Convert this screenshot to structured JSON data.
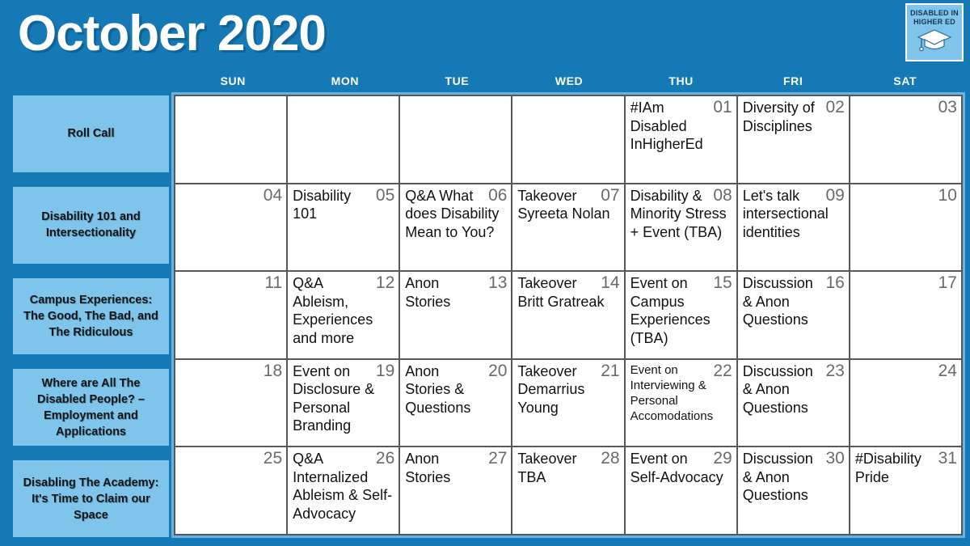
{
  "header": {
    "title": "October 2020"
  },
  "logo": {
    "line1": "DISABLED IN",
    "line2": "HIGHER ED",
    "icon": "graduation-cap-icon"
  },
  "weekdays": [
    "SUN",
    "MON",
    "TUE",
    "WED",
    "THU",
    "FRI",
    "SAT"
  ],
  "sidebar": {
    "items": [
      {
        "label": "Roll Call"
      },
      {
        "label": "Disability 101 and Intersectionality"
      },
      {
        "label": "Campus Experiences: The Good, The Bad, and The Ridiculous"
      },
      {
        "label": "Where are All The Disabled People? – Employment and Applications"
      },
      {
        "label": "Disabling The Academy: It's Time to Claim our Space"
      }
    ]
  },
  "colors": {
    "background_blue": "#1579b5",
    "light_blue": "#7fc4ea",
    "grid_border": "#57575a",
    "grid_frame": "#69b3e0",
    "day_number": "#6a6a6c",
    "cell_background": "#ffffff",
    "title_white": "#ffffff"
  },
  "calendar": {
    "weeks": [
      [
        {
          "num": "",
          "text": ""
        },
        {
          "num": "",
          "text": ""
        },
        {
          "num": "",
          "text": ""
        },
        {
          "num": "",
          "text": ""
        },
        {
          "num": "01",
          "text": "#IAm Disabled InHigherEd"
        },
        {
          "num": "02",
          "text": "Diversity of Disciplines"
        },
        {
          "num": "03",
          "text": ""
        }
      ],
      [
        {
          "num": "04",
          "text": ""
        },
        {
          "num": "05",
          "text": "Disability 101"
        },
        {
          "num": "06",
          "text": "Q&A What does Disability Mean to You?"
        },
        {
          "num": "07",
          "text": "Takeover Syreeta Nolan"
        },
        {
          "num": "08",
          "text": "Disability & Minority Stress + Event (TBA)"
        },
        {
          "num": "09",
          "text": "Let's talk intersectional identities"
        },
        {
          "num": "10",
          "text": ""
        }
      ],
      [
        {
          "num": "11",
          "text": ""
        },
        {
          "num": "12",
          "text": "Q&A Ableism, Experiences and more"
        },
        {
          "num": "13",
          "text": "Anon Stories"
        },
        {
          "num": "14",
          "text": "Takeover Britt Gratreak"
        },
        {
          "num": "15",
          "text": "Event on Campus Experiences (TBA)"
        },
        {
          "num": "16",
          "text": "Discussion & Anon Questions"
        },
        {
          "num": "17",
          "text": ""
        }
      ],
      [
        {
          "num": "18",
          "text": ""
        },
        {
          "num": "19",
          "text": "Event on Disclosure & Personal Branding"
        },
        {
          "num": "20",
          "text": "Anon Stories & Questions"
        },
        {
          "num": "21",
          "text": "Takeover Demarrius Young"
        },
        {
          "num": "22",
          "text": "Event on Interviewing & Personal Accomodations",
          "small": true
        },
        {
          "num": "23",
          "text": "Discussion & Anon Questions"
        },
        {
          "num": "24",
          "text": ""
        }
      ],
      [
        {
          "num": "25",
          "text": ""
        },
        {
          "num": "26",
          "text": "Q&A Internalized Ableism & Self-Advocacy"
        },
        {
          "num": "27",
          "text": "Anon Stories"
        },
        {
          "num": "28",
          "text": "Takeover TBA"
        },
        {
          "num": "29",
          "text": "Event on Self-Advocacy"
        },
        {
          "num": "30",
          "text": "Discussion & Anon Questions"
        },
        {
          "num": "31",
          "text": "#Disability Pride"
        }
      ]
    ]
  }
}
